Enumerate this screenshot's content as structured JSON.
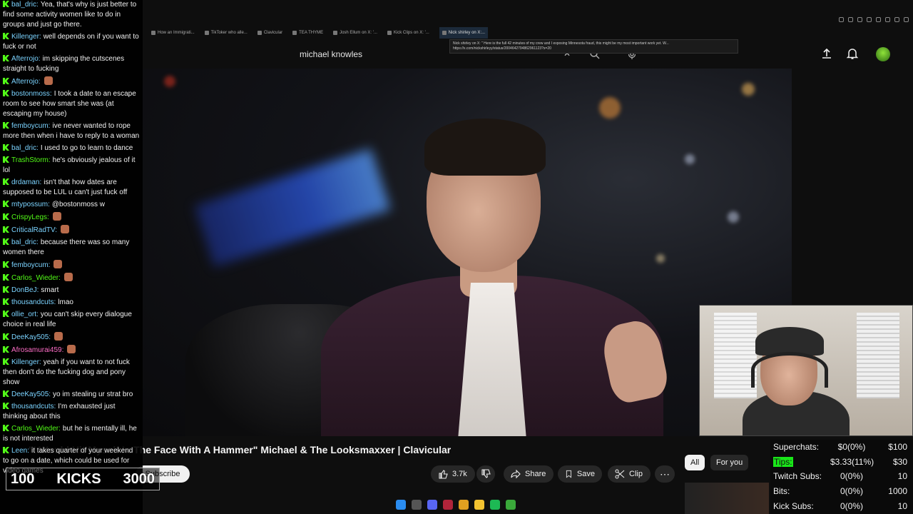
{
  "chat": {
    "messages": [
      {
        "user": "bal_dric:",
        "text": "Yea, that's why is just better to find some activity women like to do in groups and just go there.",
        "color": "blue"
      },
      {
        "user": "Killenger:",
        "text": "well depends on if you want to fuck or not",
        "color": "blue"
      },
      {
        "user": "Afterrojo:",
        "text": "im skipping the cutscenes straight to fucking",
        "color": "blue"
      },
      {
        "user": "Afterrojo:",
        "text": "",
        "color": "blue",
        "emote": true
      },
      {
        "user": "bostonmoss:",
        "text": "I took a date to an escape room to see how smart she was (at escaping my house)",
        "color": "blue"
      },
      {
        "user": "femboycum:",
        "text": "ive never wanted to rope more then when i have to reply to a woman",
        "color": "blue"
      },
      {
        "user": "bal_dric:",
        "text": "I used to go to learn to dance",
        "color": "blue"
      },
      {
        "user": "TrashStorm:",
        "text": "he's obviously jealous of it lol",
        "color": "green"
      },
      {
        "user": "drdaman:",
        "text": "isn't that how dates are supposed to be LUL u can't just fuck off",
        "color": "blue"
      },
      {
        "user": "mtypossum:",
        "text": "@bostonmoss w",
        "color": "blue"
      },
      {
        "user": "CrispyLegs:",
        "text": "",
        "color": "green",
        "emote": true
      },
      {
        "user": "CriticalRadTV:",
        "text": "",
        "color": "blue",
        "emote": true
      },
      {
        "user": "bal_dric:",
        "text": "because there was so many women there",
        "color": "blue"
      },
      {
        "user": "femboycum:",
        "text": "",
        "color": "blue",
        "emote": true
      },
      {
        "user": "Carlos_Wieder:",
        "text": "",
        "color": "green",
        "emote": true
      },
      {
        "user": "DonBeJ:",
        "text": "smart",
        "color": "blue"
      },
      {
        "user": "thousandcuts:",
        "text": "lmao",
        "color": "blue"
      },
      {
        "user": "ollie_ort:",
        "text": "you can't skip every dialogue choice in real life",
        "color": "blue"
      },
      {
        "user": "DeeKay505:",
        "text": "",
        "color": "blue",
        "emote": true
      },
      {
        "user": "Afrosamurai459:",
        "text": "",
        "color": "pink",
        "emote": true
      },
      {
        "user": "Killenger:",
        "text": "yeah if you want to not fuck then don't do the fucking dog and pony show",
        "color": "blue"
      },
      {
        "user": "DeeKay505:",
        "text": "yo im stealing ur strat bro",
        "color": "blue"
      },
      {
        "user": "thousandcuts:",
        "text": "I'm exhausted just thinking about this",
        "color": "blue"
      },
      {
        "user": "Carlos_Wieder:",
        "text": "but he is mentally ill, he is not interested",
        "color": "green"
      },
      {
        "user": "Leen:",
        "text": "it takes quarter of your weekend to go on a date, which could be used for video games",
        "color": "blue"
      }
    ]
  },
  "browser": {
    "tabs": [
      "How an Immigrati...",
      "TikToker who alle...",
      "Clavicular",
      "TEA THYME",
      "Josh Ellum on X: '...",
      "Kick Clips on X: '...",
      "Nick shirley on X:..."
    ],
    "tooltip_line1": "Nick shirley on X: \" Here is the full 42 minutes of my crew and I exposing Minnesota fraud, this might be my most important work yet. W...",
    "tooltip_line2": "https://x.com/nickshirleyy/status/2004642794862961123?s=20"
  },
  "youtube": {
    "search_value": "michael knowles",
    "video_title": "\"I Would Hit Myself In The Face With A Hammer\" Michael & The Looksmaxxer | Clavicular",
    "subscribe_label": "Subscribe",
    "like_count": "3.7k",
    "share_label": "Share",
    "save_label": "Save",
    "clip_label": "Clip",
    "chip_all": "All",
    "chip_foryou": "For you"
  },
  "kicks_goal": {
    "current": "100",
    "label": "KICKS",
    "goal": "3000"
  },
  "stats": {
    "superchats": {
      "label": "Superchats:",
      "value": "$0(0%)",
      "goal": "$100"
    },
    "tips": {
      "label": "Tips:",
      "value": "$3.33(11%)",
      "goal": "$30"
    },
    "twitch_subs": {
      "label": "Twitch Subs:",
      "value": "0(0%)",
      "goal": "10"
    },
    "bits": {
      "label": "Bits:",
      "value": "0(0%)",
      "goal": "1000"
    },
    "kick_subs": {
      "label": "Kick Subs:",
      "value": "0(0%)",
      "goal": "10"
    }
  },
  "colors": {
    "kick_green": "#53fc18",
    "tips_highlight": "#19e619",
    "chat_user_blue": "#7bd3ff"
  }
}
